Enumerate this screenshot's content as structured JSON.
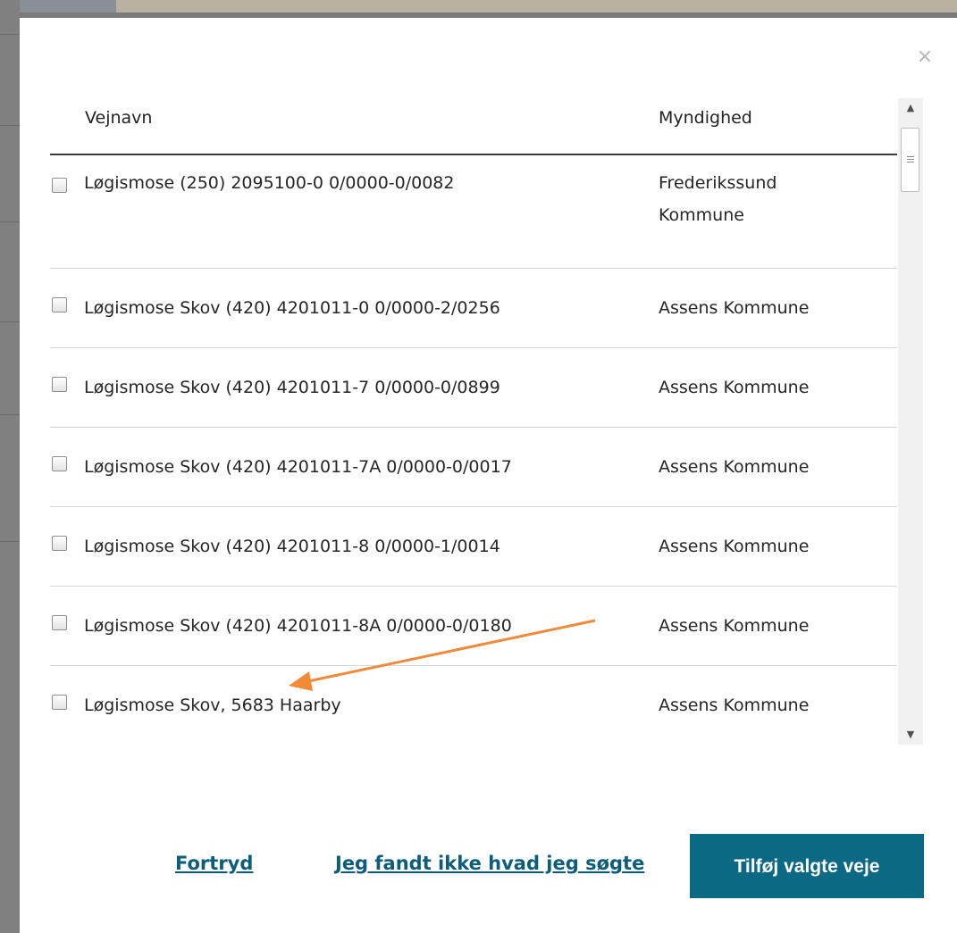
{
  "dialog": {
    "close_glyph": "×",
    "columns": {
      "name": "Vejnavn",
      "authority": "Myndighed"
    },
    "rows": [
      {
        "name": "Løgismose (250) 2095100-0 0/0000-0/0082",
        "authority": "Frederikssund Kommune"
      },
      {
        "name": "Løgismose Skov (420) 4201011-0 0/0000-2/0256",
        "authority": "Assens Kommune"
      },
      {
        "name": "Løgismose Skov (420) 4201011-7 0/0000-0/0899",
        "authority": "Assens Kommune"
      },
      {
        "name": "Løgismose Skov (420) 4201011-7A 0/0000-0/0017",
        "authority": "Assens Kommune"
      },
      {
        "name": "Løgismose Skov (420) 4201011-8 0/0000-1/0014",
        "authority": "Assens Kommune"
      },
      {
        "name": "Løgismose Skov (420) 4201011-8A 0/0000-0/0180",
        "authority": "Assens Kommune"
      },
      {
        "name": "Løgismose Skov, 5683 Haarby",
        "authority": "Assens Kommune"
      }
    ],
    "buttons": {
      "cancel": "Fortryd",
      "not_found": "Jeg fandt ikke hvad jeg søgte",
      "add": "Tilføj valgte veje"
    },
    "scrollbar": {
      "up_glyph": "▲",
      "down_glyph": "▼"
    }
  },
  "colors": {
    "primary_button": "#0b6983",
    "link": "#0b5d7a",
    "annotation_arrow": "#f28a3a"
  }
}
